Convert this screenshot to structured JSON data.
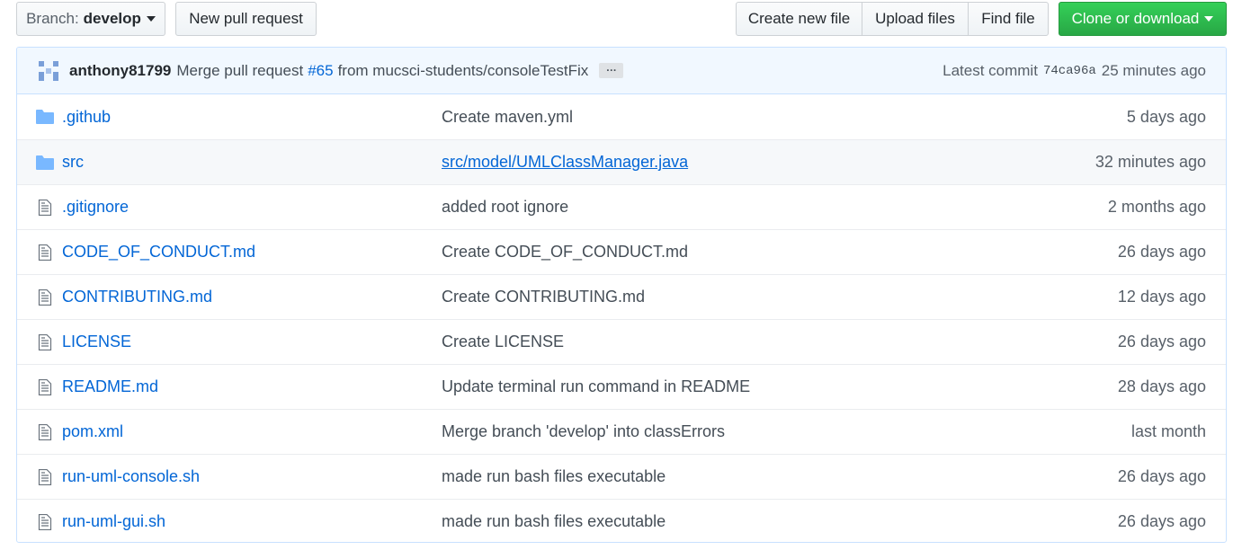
{
  "toolbar": {
    "branch_prefix": "Branch:",
    "branch_name": "develop",
    "new_pr_label": "New pull request",
    "create_file_label": "Create new file",
    "upload_label": "Upload files",
    "find_label": "Find file",
    "clone_label": "Clone or download"
  },
  "commit": {
    "author": "anthony81799",
    "message_prefix": "Merge pull request",
    "pr_number": "#65",
    "message_suffix": "from mucsci-students/consoleTestFix",
    "ellipsis": "…",
    "latest_label": "Latest commit",
    "sha": "74ca96a",
    "age": "25 minutes ago"
  },
  "files": [
    {
      "type": "folder",
      "name": ".github",
      "message": "Create maven.yml",
      "age": "5 days ago"
    },
    {
      "type": "folder",
      "name": "src",
      "message": "src/model/UMLClassManager.java",
      "age": "32 minutes ago"
    },
    {
      "type": "file",
      "name": ".gitignore",
      "message": "added root ignore",
      "age": "2 months ago"
    },
    {
      "type": "file",
      "name": "CODE_OF_CONDUCT.md",
      "message": "Create CODE_OF_CONDUCT.md",
      "age": "26 days ago"
    },
    {
      "type": "file",
      "name": "CONTRIBUTING.md",
      "message": "Create CONTRIBUTING.md",
      "age": "12 days ago"
    },
    {
      "type": "file",
      "name": "LICENSE",
      "message": "Create LICENSE",
      "age": "26 days ago"
    },
    {
      "type": "file",
      "name": "README.md",
      "message": "Update terminal run command in README",
      "age": "28 days ago"
    },
    {
      "type": "file",
      "name": "pom.xml",
      "message": "Merge branch 'develop' into classErrors",
      "age": "last month"
    },
    {
      "type": "file",
      "name": "run-uml-console.sh",
      "message": "made run bash files executable",
      "age": "26 days ago"
    },
    {
      "type": "file",
      "name": "run-uml-gui.sh",
      "message": "made run bash files executable",
      "age": "26 days ago"
    }
  ],
  "colors": {
    "link": "#0366d6",
    "clone_button": "#28a745",
    "commit_bar_bg": "#f1f8ff",
    "folder_icon": "#79b8ff"
  }
}
